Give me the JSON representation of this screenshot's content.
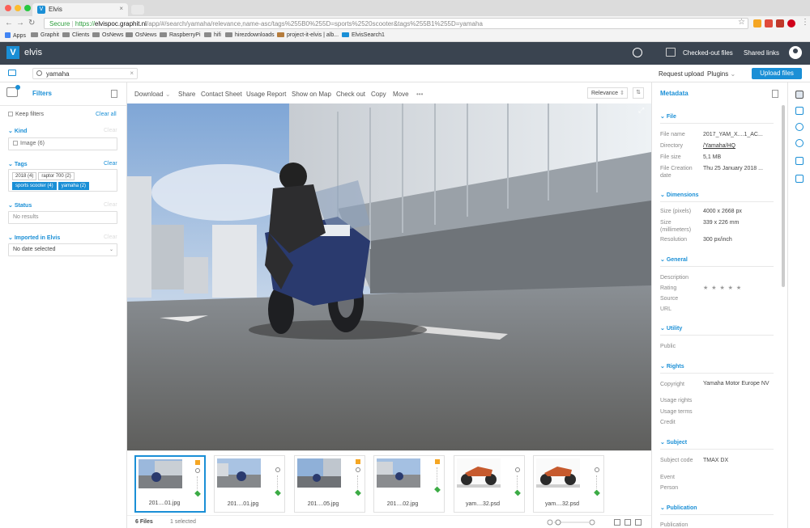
{
  "browser": {
    "tab_title": "Elvis",
    "tab_favicon": "V",
    "url_secure": "Secure",
    "url_scheme": "https://",
    "url_domain": "elvispoc.graphit.nl",
    "url_path": "/app/#/search/yamaha/relevance,name-asc/tags%255B0%255D=sports%2520scooter&tags%255B1%255D=yamaha",
    "bookmarks": [
      "Apps",
      "Graphit",
      "Clients",
      "OsNews",
      "OsNews",
      "RaspberryPi",
      "hifi",
      "hirezdownloads",
      "project-it-elvis | alb...",
      "ElvisSearch1"
    ]
  },
  "header": {
    "logo_letter": "V",
    "app_name": "elvis",
    "checked_out": "Checked-out files",
    "shared_links": "Shared links"
  },
  "search": {
    "query": "yamaha",
    "request_upload": "Request upload",
    "plugins": "Plugins",
    "upload_button": "Upload files"
  },
  "filters": {
    "title": "Filters",
    "keep_filters": "Keep filters",
    "clear_all": "Clear all",
    "clear_label": "Clear",
    "kind_title": "Kind",
    "kind_option": "Image (6)",
    "tags_title": "Tags",
    "tags": [
      {
        "label": "2018  (4)",
        "selected": false
      },
      {
        "label": "raptor 700  (2)",
        "selected": false
      },
      {
        "label": "sports scooter  (4)",
        "selected": true
      },
      {
        "label": "yamaha  (2)",
        "selected": true
      }
    ],
    "status_title": "Status",
    "status_value": "No results",
    "imported_title": "Imported in Elvis",
    "imported_value": "No date selected"
  },
  "toolbar": {
    "download": "Download",
    "share": "Share",
    "contact_sheet": "Contact Sheet",
    "usage_report": "Usage Report",
    "show_on_map": "Show on Map",
    "check_out": "Check out",
    "copy": "Copy",
    "move": "Move",
    "more": "•••",
    "sort": "Relevance"
  },
  "thumbnails": [
    {
      "name": "201....01.jpg",
      "kind": "scooter",
      "selected": true,
      "badge": true
    },
    {
      "name": "201....01.jpg",
      "kind": "scooter",
      "selected": false,
      "badge": false
    },
    {
      "name": "201....05.jpg",
      "kind": "scooter",
      "selected": false,
      "badge": true
    },
    {
      "name": "201....02.jpg",
      "kind": "scooter",
      "selected": false,
      "badge": true
    },
    {
      "name": "yam....32.psd",
      "kind": "atv",
      "selected": false,
      "badge": false
    },
    {
      "name": "yam....32.psd",
      "kind": "atv",
      "selected": false,
      "badge": false
    }
  ],
  "status": {
    "files": "6 Files",
    "selected": "1 selected"
  },
  "metadata": {
    "title": "Metadata",
    "sections": {
      "file": "File",
      "dimensions": "Dimensions",
      "general": "General",
      "utility": "Utility",
      "rights": "Rights",
      "subject": "Subject",
      "publication": "Publication"
    },
    "file_name_label": "File name",
    "file_name": "2017_YAM_X....1_AC...",
    "directory_label": "Directory",
    "directory": "/Yamaha/HQ",
    "file_size_label": "File size",
    "file_size": "5,1 MB",
    "file_creation_label": "File Creation date",
    "file_creation": "Thu 25 January 2018 ...",
    "size_px_label": "Size (pixels)",
    "size_px": "4000 x 2668 px",
    "size_mm_label": "Size (millimeters)",
    "size_mm": "339 x 226 mm",
    "resolution_label": "Resolution",
    "resolution": "300 px/inch",
    "description_label": "Description",
    "rating_label": "Rating",
    "rating_stars": "★ ★ ★ ★ ★",
    "source_label": "Source",
    "url_label": "URL",
    "public_label": "Public",
    "copyright_label": "Copyright",
    "copyright": "Yamaha Motor Europe NV",
    "usage_rights_label": "Usage rights",
    "usage_terms_label": "Usage terms",
    "credit_label": "Credit",
    "subject_code_label": "Subject code",
    "subject_code": "TMAX DX",
    "event_label": "Event",
    "person_label": "Person",
    "publication_label": "Publication"
  },
  "colors": {
    "accent": "#1a8fd6",
    "header_bg": "#3a4450",
    "tag_green": "#3cab45",
    "badge_orange": "#f5a623"
  }
}
